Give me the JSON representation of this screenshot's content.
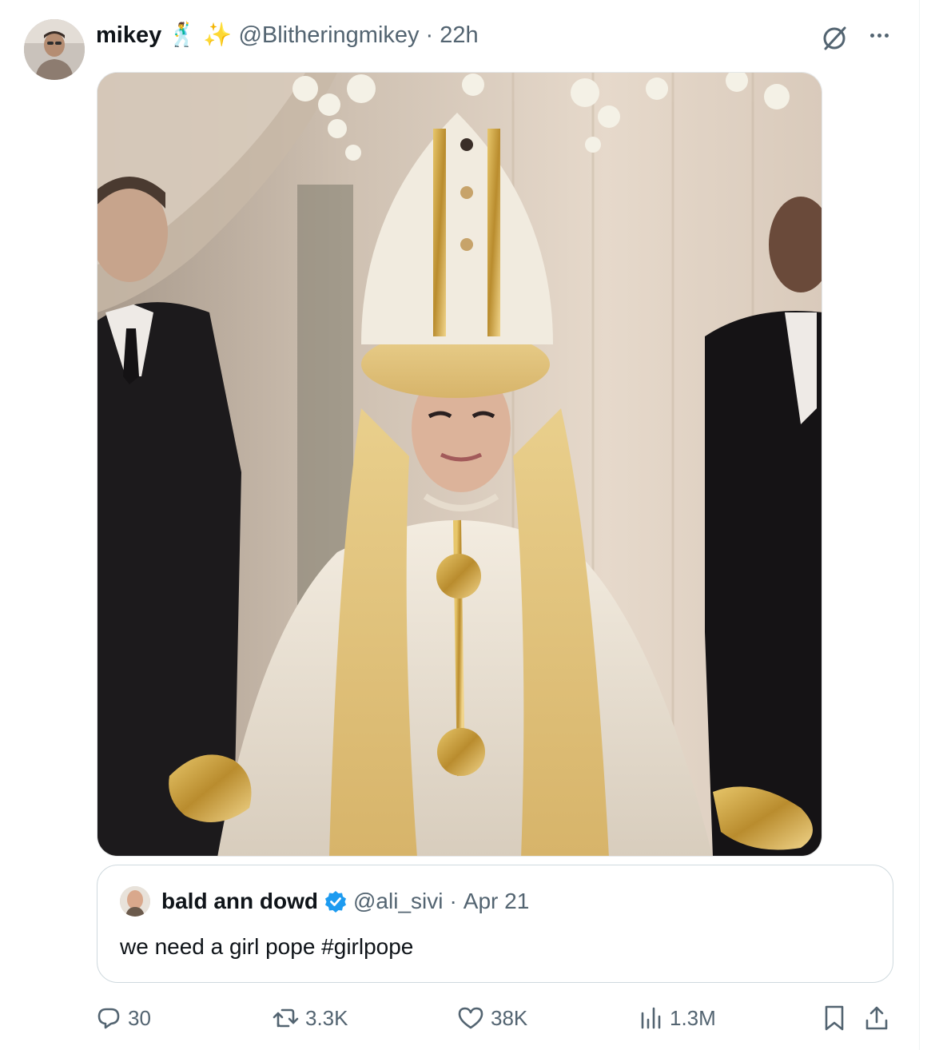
{
  "tweet": {
    "display_name": "mikey",
    "name_emoji_1": "🕺",
    "name_emoji_2": "✨",
    "handle": "@Blitheringmikey",
    "separator": "·",
    "time": "22h",
    "avatar_icon": "user-avatar",
    "grok_icon": "grok-icon",
    "more_icon": "more-options-icon"
  },
  "media": {
    "alt": "person in white papal robes, mitre and long blonde wig"
  },
  "quote": {
    "display_name": "bald ann dowd",
    "verified_icon": "verified-badge-icon",
    "handle": "@ali_sivi",
    "separator": "·",
    "date": "Apr 21",
    "text": "we need a girl pope #girlpope"
  },
  "actions": {
    "replies": "30",
    "reposts": "3.3K",
    "likes": "38K",
    "views": "1.3M",
    "icons": [
      "reply-icon",
      "repost-icon",
      "like-icon",
      "views-icon",
      "bookmark-icon",
      "share-icon"
    ]
  },
  "colors": {
    "text_primary": "#0f1419",
    "text_secondary": "#536471",
    "verified_blue": "#1d9bf0",
    "border": "#cfd9de"
  }
}
